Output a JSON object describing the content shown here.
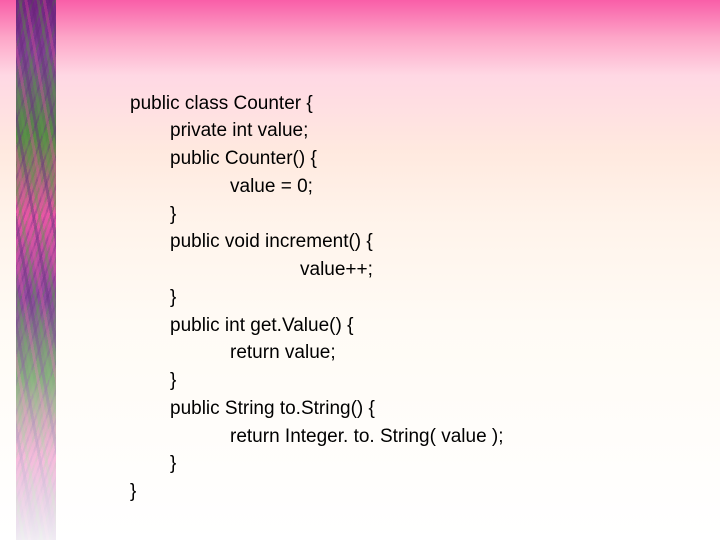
{
  "code": {
    "l0": "public class Counter {",
    "l1": "private int value;",
    "l2": "public Counter() {",
    "l3": "value = 0;",
    "l4": "}",
    "l5": "public void increment() {",
    "l6": "value++;",
    "l7": "}",
    "l8": "public int get.Value() {",
    "l9": "return value;",
    "l10": "}",
    "l11": "public String to.String() {",
    "l12": "return Integer. to. String( value );",
    "l13": "}",
    "l14": "}"
  }
}
